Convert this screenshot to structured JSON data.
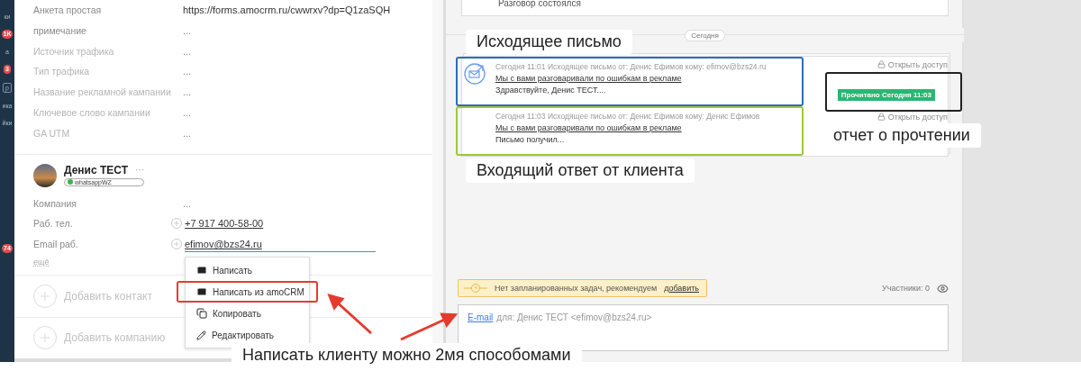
{
  "sidebar": {
    "items": [
      {
        "kind": "label",
        "label": "ки"
      },
      {
        "kind": "badge",
        "badge": "1K"
      },
      {
        "kind": "label",
        "label": "а"
      },
      {
        "kind": "badge",
        "badge": "3"
      },
      {
        "kind": "boxed",
        "label": "р"
      },
      {
        "kind": "label",
        "label": "ика"
      },
      {
        "kind": "label",
        "label": "йки"
      },
      {
        "kind": "badge",
        "badge": "74"
      }
    ]
  },
  "lead_fields": [
    {
      "label": "Анкета простая",
      "value": "https://forms.amocrm.ru/cwwrxv?dp=Q1zaSQH",
      "filled": true
    },
    {
      "label": "примечание",
      "value": "...",
      "filled": true
    },
    {
      "label": "Источник трафика",
      "value": "...",
      "filled": false
    },
    {
      "label": "Тип трафика",
      "value": "...",
      "filled": false
    },
    {
      "label": "Название рекламной кампании",
      "value": "...",
      "filled": false
    },
    {
      "label": "Ключевое слово кампании",
      "value": "...",
      "filled": false
    },
    {
      "label": "GA UTM",
      "value": "...",
      "filled": false
    }
  ],
  "contact": {
    "name": "Денис ТЕСТ",
    "more": "···",
    "messenger": "whatsappWZ",
    "fields": [
      {
        "label": "Компания",
        "value": "...",
        "kind": "text"
      },
      {
        "label": "Раб. тел.",
        "value": "+7 917 400-58-00",
        "kind": "link"
      },
      {
        "label": "Email раб.",
        "value": "efimov@bzs24.ru",
        "kind": "editing"
      }
    ],
    "show_more": "ещё"
  },
  "add_contact": "Добавить контакт",
  "add_company": "Добавить компанию",
  "context_menu": {
    "items": [
      {
        "kind": "mail",
        "label": "Написать",
        "highlighted": false
      },
      {
        "kind": "mail",
        "label": "Написать из amoCRM",
        "highlighted": true
      },
      {
        "kind": "copy",
        "label": "Копировать",
        "highlighted": false
      },
      {
        "kind": "edit",
        "label": "Редактировать",
        "highlighted": false
      }
    ]
  },
  "feed": {
    "previous_note": "Разговор состоялся",
    "date_divider": "Сегодня",
    "emails": [
      {
        "kind": "outgoing",
        "color": "#2f6db5",
        "meta": "Сегодня 11:01 Исходящее письмо от: Денис Ефимов кому: efimov@bzs24.ru",
        "subject": "Мы с вами разговаривали по ошибкам в рекламе",
        "preview": "Здравствуйте, Денис ТЕСТ....",
        "access": "Открыть доступ"
      },
      {
        "kind": "reply",
        "color": "#9cc83c",
        "meta": "Сегодня 11:03 Исходящее письмо от: Денис Ефимов кому: Денис Ефимов",
        "subject": "Мы с вами разговаривали по ошибкам в рекламе",
        "preview": "Письмо получил...",
        "access": "Открыть доступ"
      }
    ],
    "read_receipt": "Прочитано Сегодня 11:03",
    "task_notice": {
      "text": "Нет запланированных задач, рекомендуем",
      "link": "добавить"
    },
    "participants": "Участники: 0",
    "compose": {
      "channel": "E-mail",
      "recipient": "для: Денис ТЕСТ <efimov@bzs24.ru>"
    }
  },
  "callouts": [
    {
      "text": "Исходящее письмо"
    },
    {
      "text": "Входящий ответ от клиента"
    },
    {
      "text": "отчет о прочтении"
    },
    {
      "text": "Написать клиенту можно 2мя способомами"
    }
  ]
}
